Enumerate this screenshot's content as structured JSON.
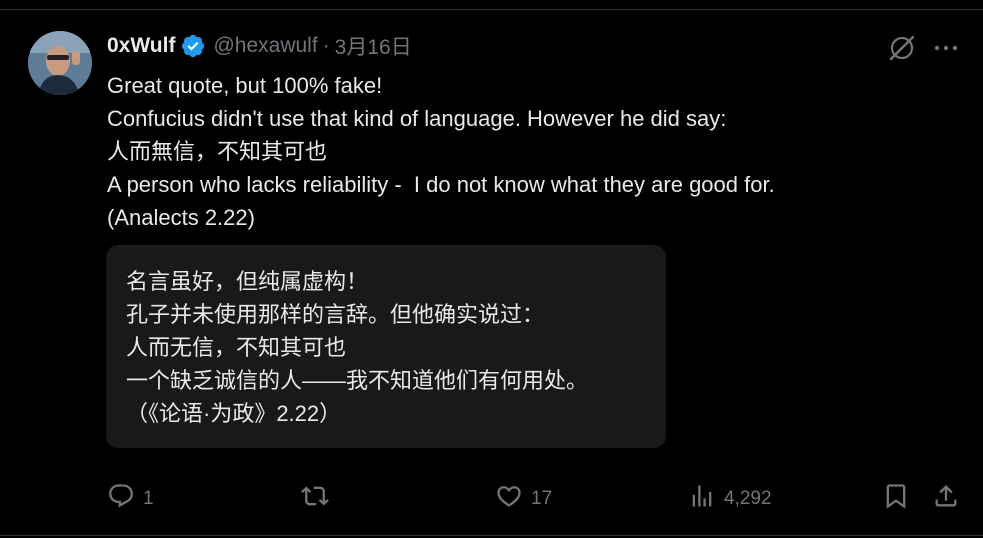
{
  "author": {
    "display_name": "0xWulf",
    "handle": "@hexawulf",
    "separator": "·",
    "date": "3月16日",
    "verified": true
  },
  "tweet": {
    "lines": [
      "Great quote, but 100% fake!",
      "Confucius didn't use that kind of language. However he did say:",
      "人而無信，不知其可也",
      "A person who lacks reliability -  I do not know what they are good for.",
      "(Analects 2.22)"
    ]
  },
  "translation": {
    "lines": [
      "名言虽好，但纯属虚构！",
      "孔子并未使用那样的言辞。但他确实说过：",
      "人而无信，不知其可也",
      "一个缺乏诚信的人——我不知道他们有何用处。",
      "（《论语·为政》2.22）"
    ]
  },
  "actions": {
    "reply_count": "1",
    "repost_count": "",
    "like_count": "17",
    "view_count": "4,292"
  },
  "icons": {
    "avatar": "avatar",
    "verified": "verified-badge-icon",
    "grok": "grok-icon",
    "more": "more-icon",
    "reply": "reply-icon",
    "repost": "repost-icon",
    "like": "heart-icon",
    "views": "views-chart-icon",
    "bookmark": "bookmark-icon",
    "share": "share-icon"
  },
  "colors": {
    "background": "#000000",
    "text": "#e7e9ea",
    "secondary_text": "#71767b",
    "verified_blue": "#1d9bf0",
    "divider": "#2f3336",
    "translation_background": "#1a1818"
  }
}
